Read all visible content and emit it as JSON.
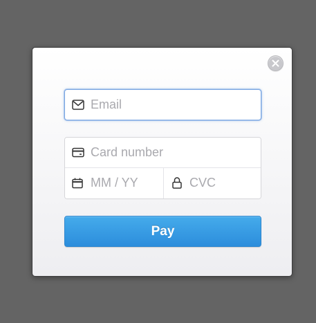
{
  "colors": {
    "backdrop": "#646464",
    "focus_border": "#7fa9e3",
    "pay_button": "#2c8ddc",
    "placeholder_text": "#a9a9ae"
  },
  "modal": {
    "close_icon": "close-icon",
    "email": {
      "icon": "envelope-icon",
      "placeholder": "Email",
      "value": ""
    },
    "card_number": {
      "icon": "credit-card-icon",
      "placeholder": "Card number",
      "value": ""
    },
    "expiry": {
      "icon": "calendar-icon",
      "placeholder": "MM / YY",
      "value": ""
    },
    "cvc": {
      "icon": "lock-icon",
      "placeholder": "CVC",
      "value": ""
    },
    "pay_label": "Pay"
  }
}
